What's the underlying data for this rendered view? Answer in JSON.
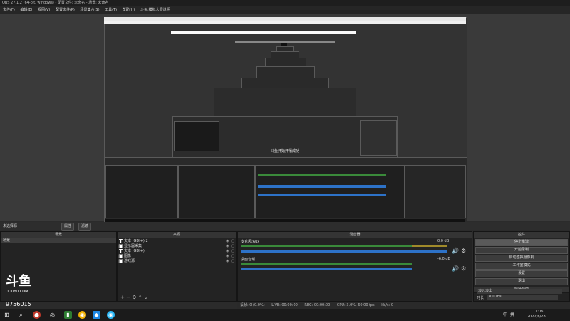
{
  "window": {
    "title": "OBS 27.1.2 (64-bit, windows) - 配置文件: 未命名 - 场景: 未命名"
  },
  "menu": [
    "文件(F)",
    "编辑(E)",
    "视图(V)",
    "配置文件(P)",
    "场景集合(S)",
    "工具(T)",
    "帮助(H)",
    "斗鱼:模拟大赛说明"
  ],
  "preview": {
    "toast": "斗鱼开始开播成功"
  },
  "strip": {
    "label": "未选择源",
    "props": "属性",
    "filters": "滤镜"
  },
  "scenes": {
    "title": "场景",
    "items": [
      "场景"
    ]
  },
  "sources": {
    "title": "来源",
    "items": [
      {
        "type": "T",
        "name": "文本 (GDI+) 2"
      },
      {
        "type": "▣",
        "name": "显示器采集"
      },
      {
        "type": "T",
        "name": "文本 (GDI+)"
      },
      {
        "type": "▣",
        "name": "图像"
      },
      {
        "type": "▣",
        "name": "游戏源"
      }
    ]
  },
  "mixer": {
    "title": "混音器",
    "channels": [
      {
        "name": "桌面音频",
        "db": "-6.0 dB"
      },
      {
        "name": "麦克风/Aux",
        "db": "0.0 dB"
      }
    ]
  },
  "controls": {
    "title": "控件",
    "buttons": [
      "停止推流",
      "开始录制",
      "启动虚拟摄像机",
      "工作室模式",
      "设置",
      "退出"
    ]
  },
  "transitions": {
    "title": "转场特效",
    "type": "淡入淡出",
    "duration_label": "时长",
    "duration": "300 ms"
  },
  "status": {
    "drop": "丢帧: 0 (0.0%)",
    "live": "LIVE: 00:00:00",
    "rec": "REC: 00:00:00",
    "cpu": "CPU: 3.0%, 60.00 fps",
    "kbps": "kb/s: 0"
  },
  "clock": {
    "time": "11:06",
    "date": "2022/6/28"
  },
  "watermark": {
    "brand": "斗鱼",
    "site": "DOUYU.COM",
    "room": "9756015"
  },
  "tray": {
    "lang": "中",
    "ime": "拼"
  }
}
